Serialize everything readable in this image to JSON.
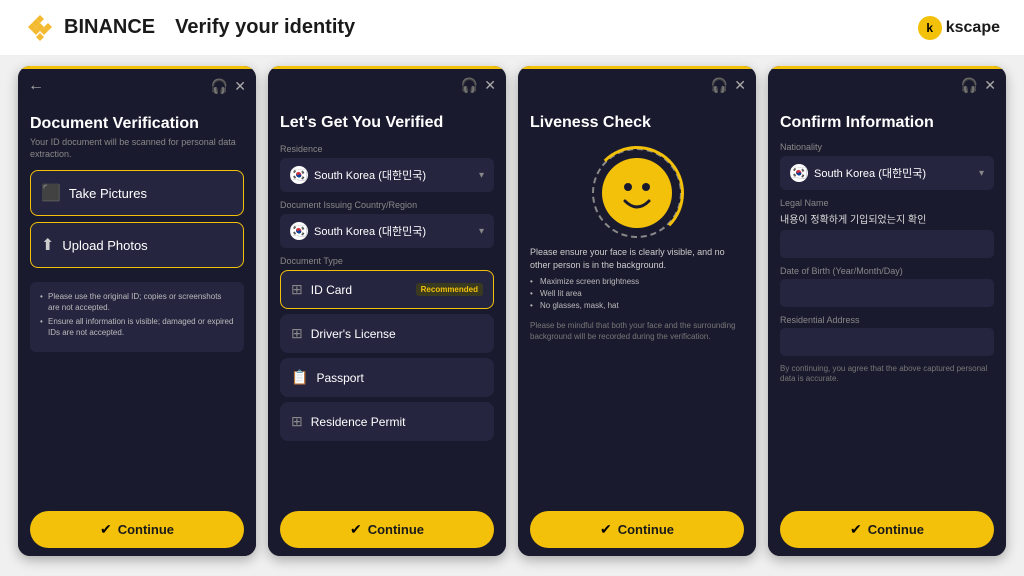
{
  "header": {
    "brand": "BINANCE",
    "title": "Verify your identity",
    "kscape": "kscape"
  },
  "screens": [
    {
      "id": "screen1",
      "title": "Document Verification",
      "subtitle": "Your ID document will be scanned for personal data extraction.",
      "options": [
        {
          "label": "Take Pictures",
          "icon": "📷"
        },
        {
          "label": "Upload Photos",
          "icon": "⬆"
        }
      ],
      "info": [
        "Please use the original ID; copies or screenshots are not accepted.",
        "Ensure all information is visible; damaged or expired IDs are not accepted."
      ],
      "continue": "Continue"
    },
    {
      "id": "screen2",
      "title": "Let's Get You Verified",
      "residence_label": "Residence",
      "residence_value": "South Korea (대한민국)",
      "doc_issuing_label": "Document Issuing Country/Region",
      "doc_issuing_value": "South Korea (대한민국)",
      "doc_type_label": "Document Type",
      "doc_types": [
        {
          "label": "ID Card",
          "recommended": true,
          "selected": true
        },
        {
          "label": "Driver's License",
          "recommended": false,
          "selected": false
        },
        {
          "label": "Passport",
          "recommended": false,
          "selected": false
        },
        {
          "label": "Residence Permit",
          "recommended": false,
          "selected": false
        }
      ],
      "recommended_text": "Recommended",
      "continue": "Continue"
    },
    {
      "id": "screen3",
      "title": "Liveness Check",
      "description": "Please ensure your face is clearly visible, and no other person is in the background.",
      "bullets": [
        "Maximize screen brightness",
        "Well lit area",
        "No glasses, mask, hat"
      ],
      "footer": "Please be mindful that both your face and the surrounding background will be recorded during the verification.",
      "continue": "Continue"
    },
    {
      "id": "screen4",
      "title": "Confirm Information",
      "nationality_label": "Nationality",
      "nationality_value": "South Korea (대한민국)",
      "legal_name_label": "Legal Name",
      "legal_name_text": "내용이 정확하게 기입되었는지 확인",
      "dob_label": "Date of Birth (Year/Month/Day)",
      "addr_label": "Residential Address",
      "agree_text": "By continuing, you agree that the above captured personal data is accurate.",
      "continue": "Continue"
    }
  ]
}
